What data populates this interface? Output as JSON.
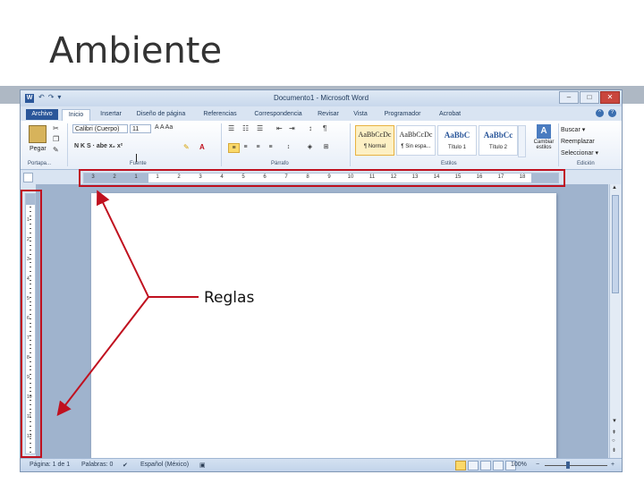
{
  "slide": {
    "title": "Ambiente"
  },
  "window": {
    "title": "Documento1 - Microsoft Word",
    "qat": [
      "↶",
      "↷",
      "▾"
    ],
    "controls": [
      "–",
      "□",
      "✕"
    ]
  },
  "tabs": [
    "Archivo",
    "Inicio",
    "Insertar",
    "Diseño de página",
    "Referencias",
    "Correspondencia",
    "Revisar",
    "Vista",
    "Programador",
    "Acrobat"
  ],
  "ribbon": {
    "clipboard": {
      "paste_label": "Pegar",
      "group": "Portapa..."
    },
    "font": {
      "name": "Calibri (Cuerpo)",
      "size": "11",
      "group": "Fuente",
      "row1": "A A Aa",
      "row2": "N K S · abe x₂ x²"
    },
    "paragraph": {
      "group": "Párrafo",
      "pilcrow": "¶"
    },
    "styles": {
      "group": "Estilos",
      "items": [
        {
          "sample": "AaBbCcDc",
          "name": "¶ Normal"
        },
        {
          "sample": "AaBbCcDc",
          "name": "¶ Sin espa..."
        },
        {
          "sample": "AaBbC",
          "name": "Título 1"
        },
        {
          "sample": "AaBbCc",
          "name": "Título 2"
        }
      ],
      "change_label": "Cambiar estilos"
    },
    "editing": {
      "group": "Edición",
      "items": [
        "Buscar ▾",
        "Reemplazar",
        "Seleccionar ▾"
      ]
    }
  },
  "ruler": {
    "h_numbers": [
      "3",
      "2",
      "1",
      "1",
      "2",
      "3",
      "4",
      "5",
      "6",
      "7",
      "8",
      "9",
      "10",
      "11",
      "12",
      "13",
      "14",
      "15",
      "16",
      "17",
      "18"
    ],
    "v_numbers": [
      "1",
      "2",
      "3",
      "4",
      "5",
      "6",
      "7",
      "8",
      "9",
      "10",
      "11",
      "12"
    ]
  },
  "statusbar": {
    "page": "Página: 1 de 1",
    "words": "Palabras: 0",
    "language": "Español (México)",
    "zoom": "100%",
    "zoom_minus": "−",
    "zoom_plus": "+"
  },
  "annotation": {
    "label": "Reglas"
  },
  "colors": {
    "annotation_red": "#c0111f",
    "word_blue": "#2b579a"
  }
}
